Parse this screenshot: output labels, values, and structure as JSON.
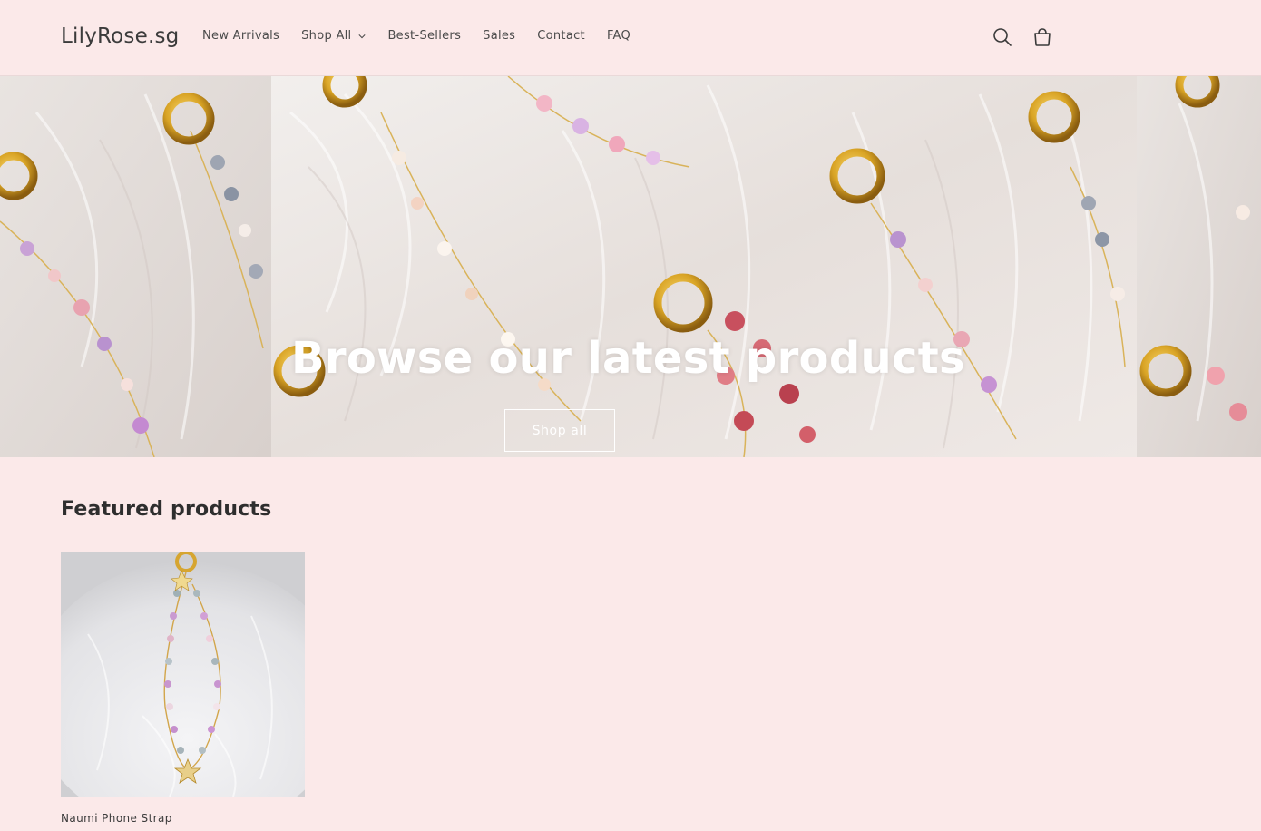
{
  "header": {
    "logo": "LilyRose.sg",
    "nav": [
      {
        "label": "New Arrivals"
      },
      {
        "label": "Shop All",
        "has_dropdown": true
      },
      {
        "label": "Best-Sellers"
      },
      {
        "label": "Sales"
      },
      {
        "label": "Contact"
      },
      {
        "label": "FAQ"
      }
    ],
    "icons": [
      "search-icon",
      "cart-icon"
    ]
  },
  "hero": {
    "title": "Browse our latest products",
    "button_label": "Shop all"
  },
  "featured": {
    "title": "Featured products",
    "products": [
      {
        "name": "Naumi Phone Strap"
      }
    ]
  },
  "colors": {
    "background": "#fbe9e9",
    "text": "#3a3a3a",
    "hero_text": "#ffffff"
  }
}
